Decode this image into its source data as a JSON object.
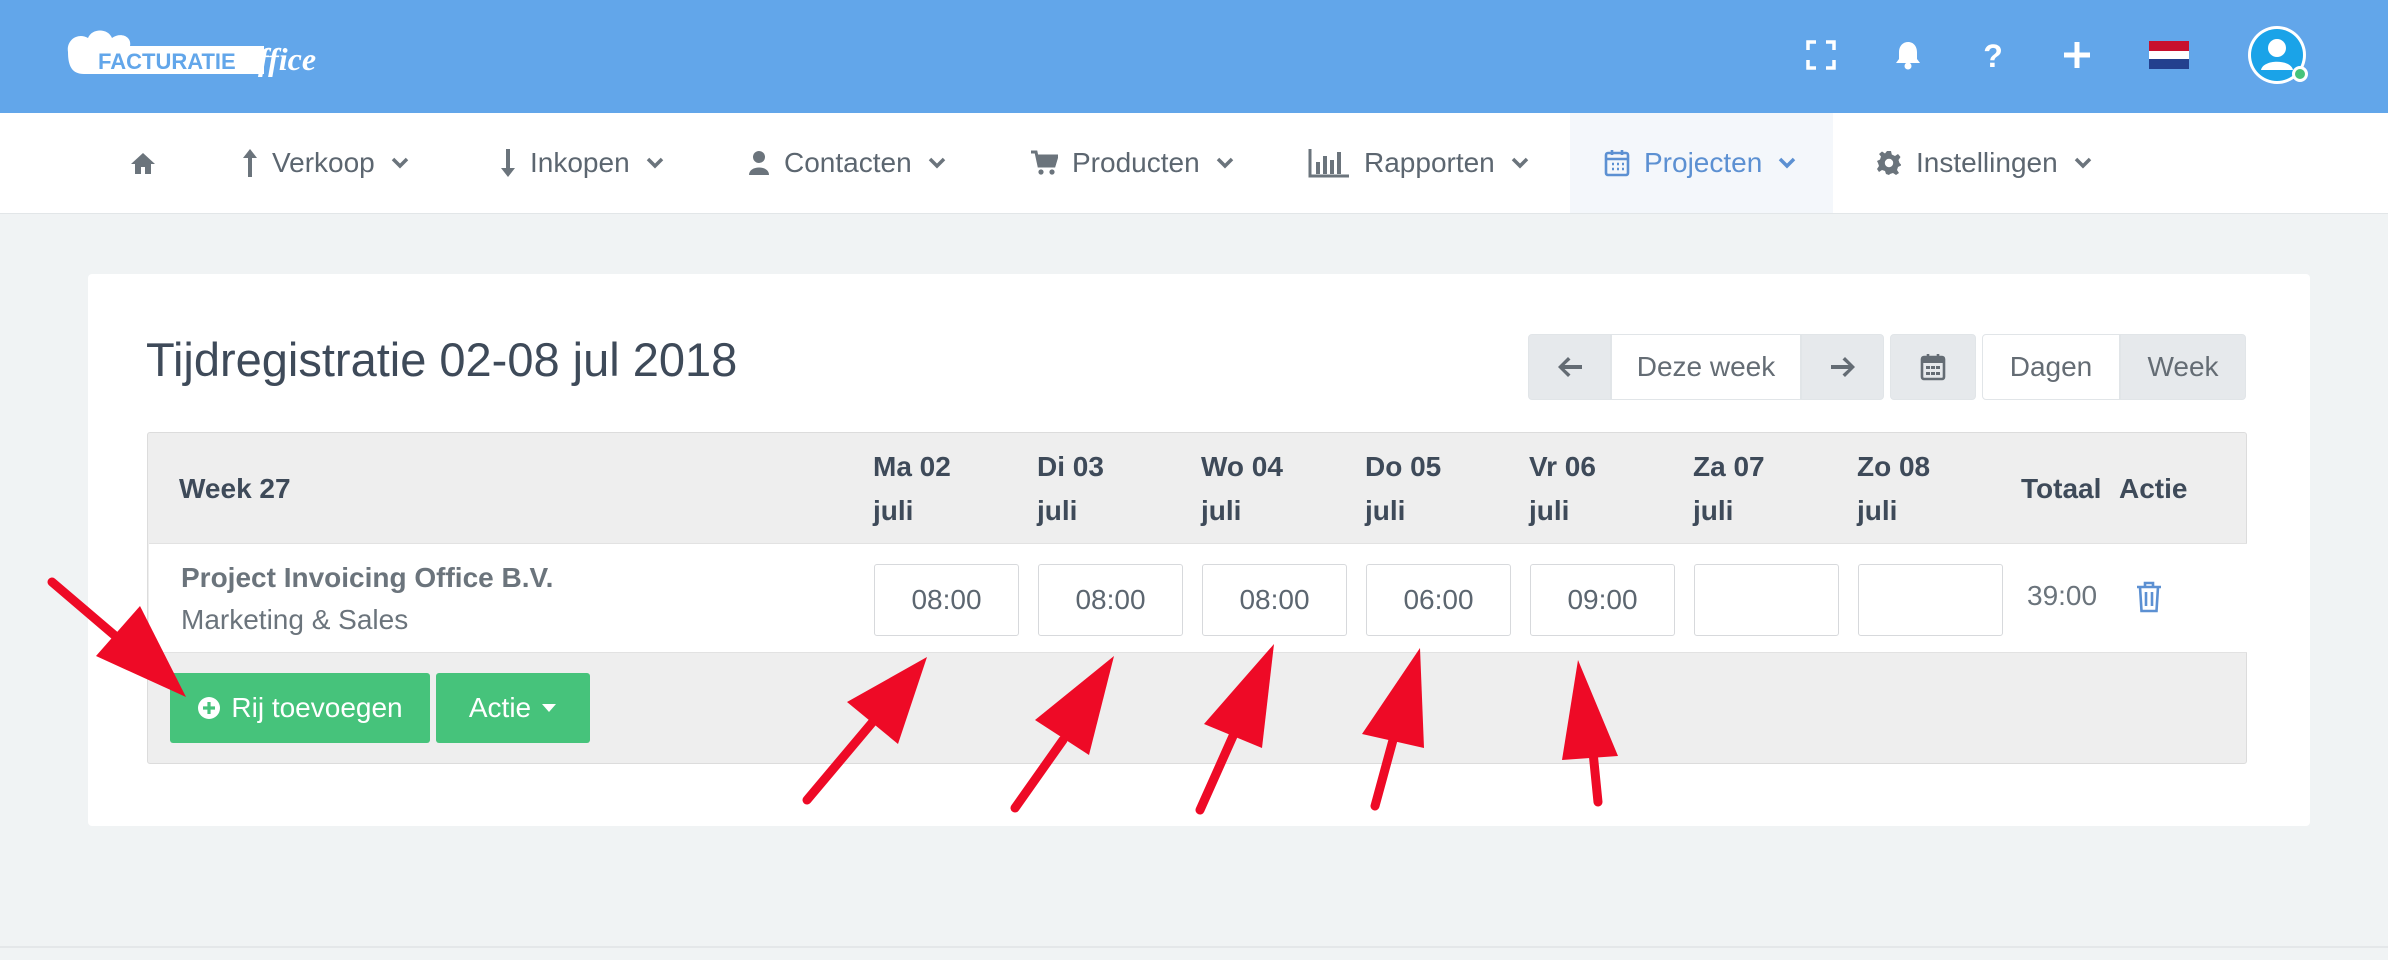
{
  "header": {
    "logo_text": "FACTURATIEoffice",
    "logo_script": "office",
    "icons": [
      "fullscreen-icon",
      "bell-icon",
      "question-icon",
      "plus-icon",
      "flag-nl-icon"
    ],
    "colors": {
      "topbar": "#62a6ea",
      "accent": "#5c90d2",
      "green": "#46c37b",
      "arrow": "#ee0a26"
    }
  },
  "nav": {
    "items": [
      {
        "label": "",
        "icon": "home-icon"
      },
      {
        "label": "Verkoop",
        "icon": "arrow-up-icon"
      },
      {
        "label": "Inkopen",
        "icon": "arrow-down-icon"
      },
      {
        "label": "Contacten",
        "icon": "user-icon"
      },
      {
        "label": "Producten",
        "icon": "cart-icon"
      },
      {
        "label": "Rapporten",
        "icon": "bar-chart-icon"
      },
      {
        "label": "Projecten",
        "icon": "calendar-icon",
        "active": true
      },
      {
        "label": "Instellingen",
        "icon": "gear-icon"
      }
    ]
  },
  "page": {
    "title": "Tijdregistratie 02-08 jul 2018",
    "toolbar": {
      "this_week": "Deze week",
      "days": "Dagen",
      "week": "Week"
    }
  },
  "table": {
    "week_label": "Week 27",
    "days": [
      {
        "day": "Ma 02",
        "month": "juli"
      },
      {
        "day": "Di 03",
        "month": "juli"
      },
      {
        "day": "Wo 04",
        "month": "juli"
      },
      {
        "day": "Do 05",
        "month": "juli"
      },
      {
        "day": "Vr 06",
        "month": "juli"
      },
      {
        "day": "Za 07",
        "month": "juli"
      },
      {
        "day": "Zo 08",
        "month": "juli"
      }
    ],
    "total_header": "Totaal",
    "action_header": "Actie",
    "rows": [
      {
        "project": "Project Invoicing Office B.V.",
        "subtitle": "Marketing & Sales",
        "times": [
          "08:00",
          "08:00",
          "08:00",
          "06:00",
          "09:00",
          "",
          ""
        ],
        "total": "39:00"
      }
    ]
  },
  "footer_buttons": {
    "add_row": "Rij toevoegen",
    "action": "Actie"
  }
}
